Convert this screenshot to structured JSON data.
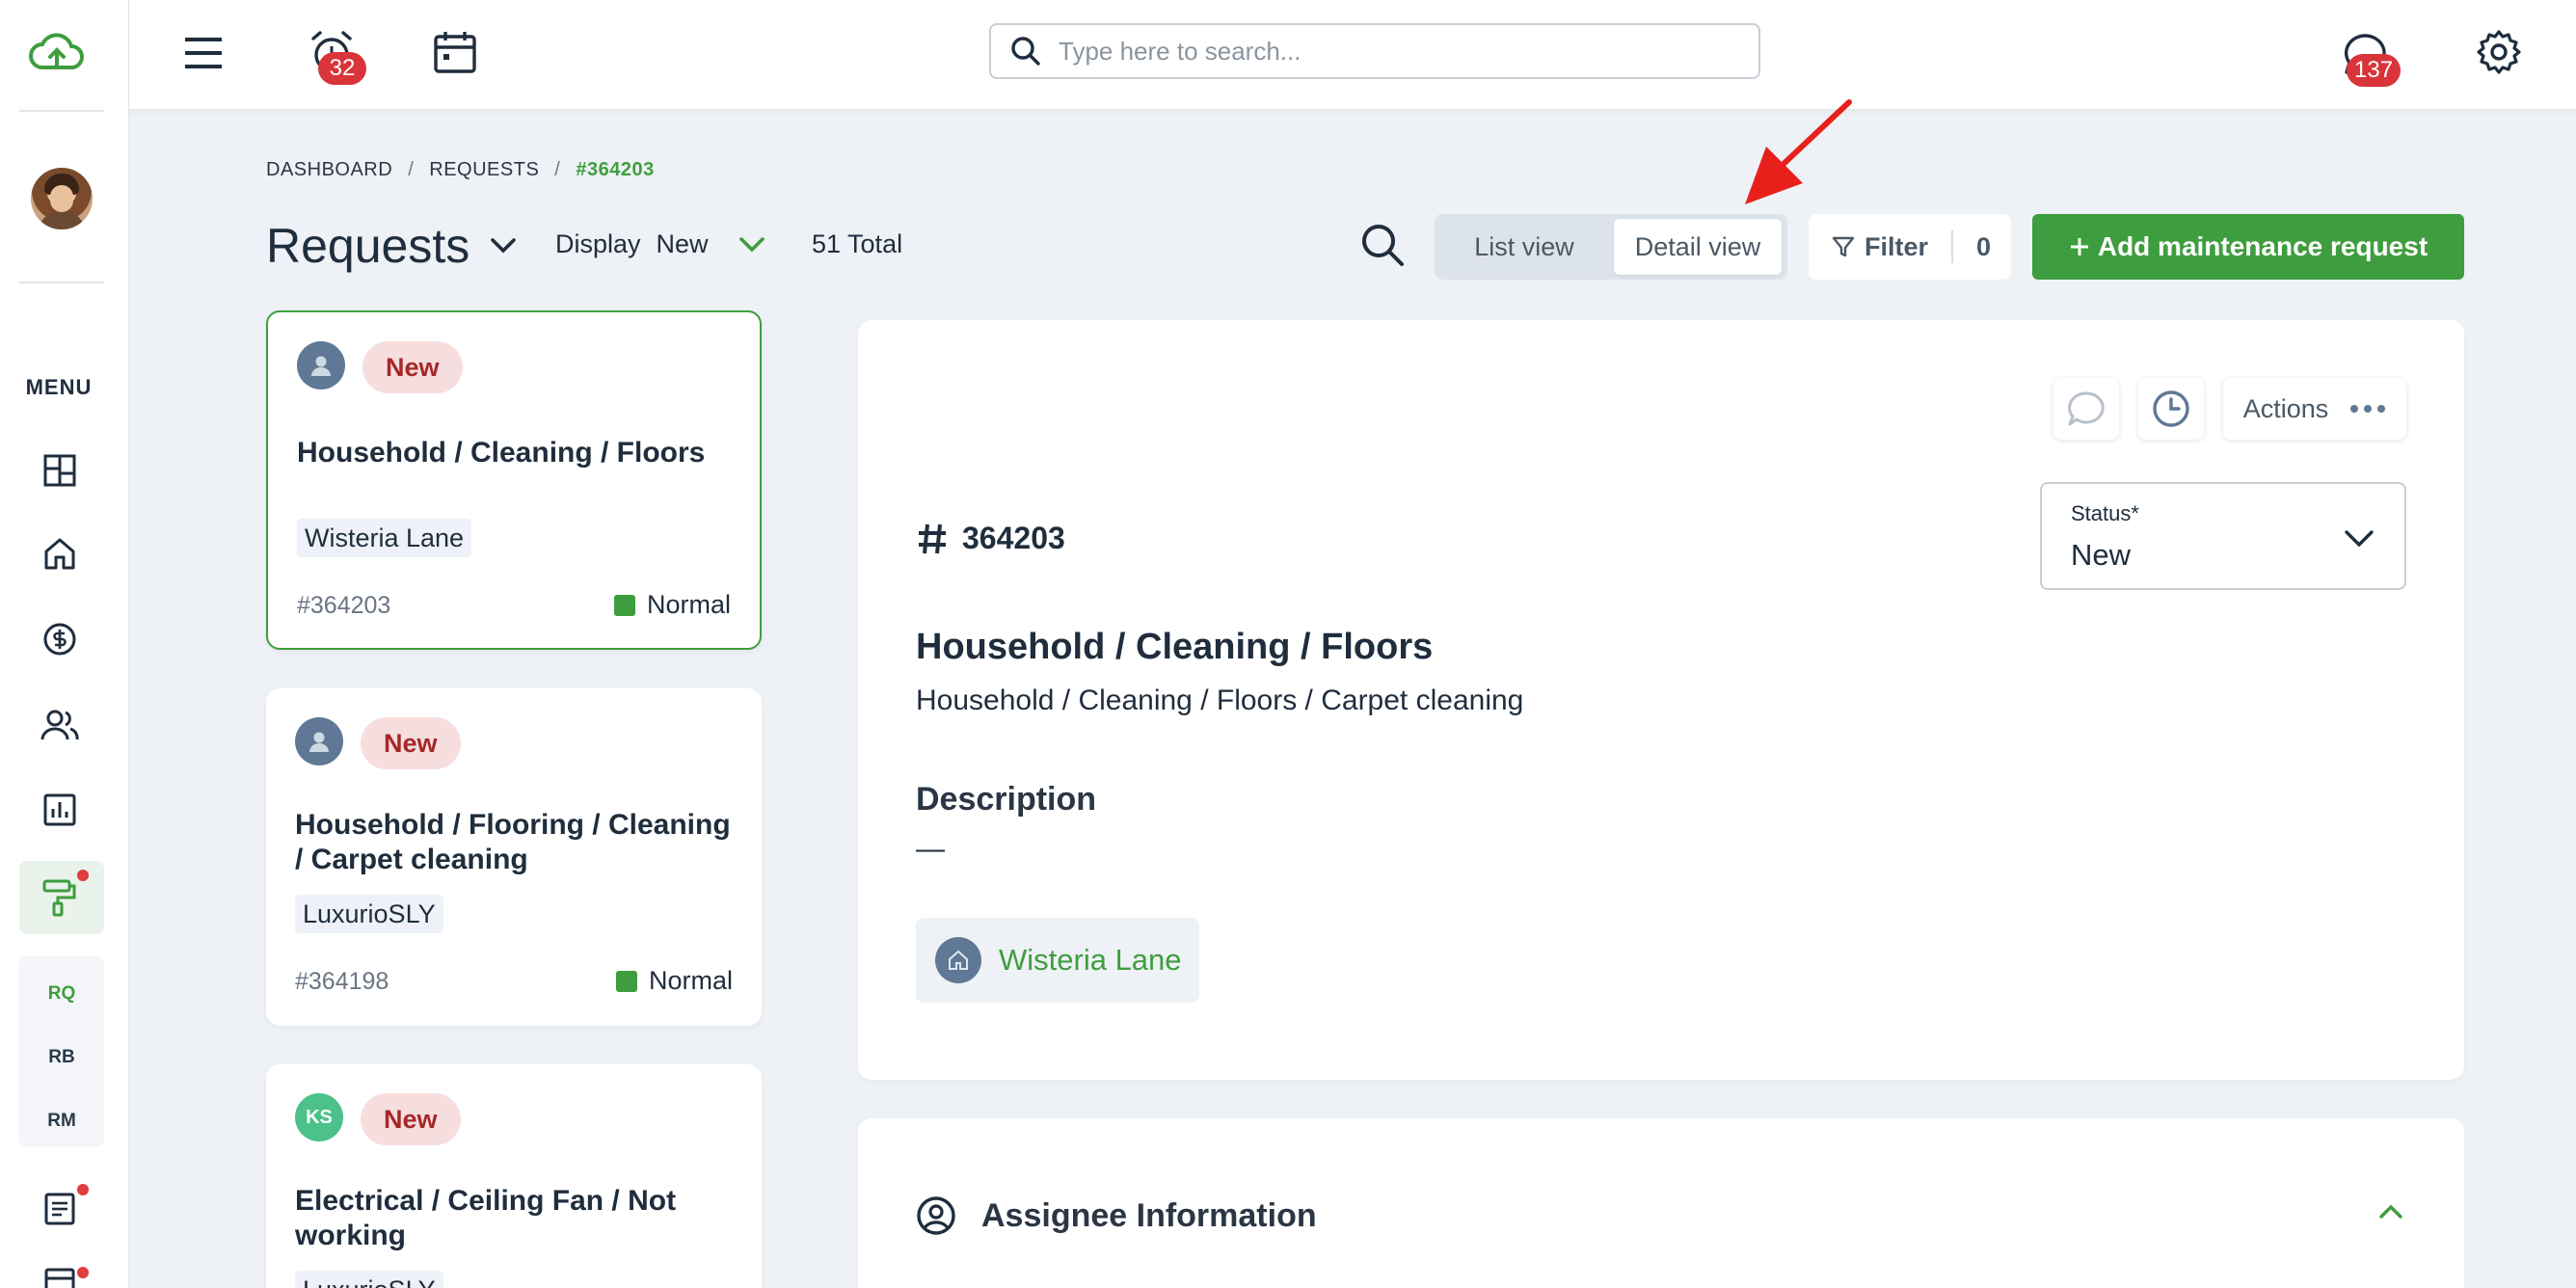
{
  "topbar": {
    "alarm_badge": "32",
    "chat_badge": "137",
    "search_placeholder": "Type here to search..."
  },
  "sidebar": {
    "menu_label": "MENU",
    "sub_items": [
      "RQ",
      "RB",
      "RM"
    ]
  },
  "breadcrumb": {
    "items": [
      "DASHBOARD",
      "REQUESTS"
    ],
    "current": "#364203",
    "separator": "/"
  },
  "header": {
    "title": "Requests",
    "display_label": "Display",
    "display_value": "New",
    "total": "51 Total",
    "list_view": "List view",
    "detail_view": "Detail view",
    "filter_label": "Filter",
    "filter_count": "0",
    "add_button": "Add maintenance request"
  },
  "cards": [
    {
      "status": "New",
      "title": "Household / Cleaning / Floors",
      "property": "Wisteria Lane",
      "id": "#364203",
      "priority": "Normal"
    },
    {
      "status": "New",
      "title": "Household / Flooring / Cleaning / Carpet cleaning",
      "property": "LuxurioSLY",
      "id": "#364198",
      "priority": "Normal"
    },
    {
      "status": "New",
      "title": "Electrical / Ceiling Fan / Not working",
      "avatar_initials": "KS",
      "property": "LuxurioSLY"
    }
  ],
  "detail": {
    "actions_label": "Actions",
    "status_label": "Status*",
    "status_value": "New",
    "id": "364203",
    "title": "Household / Cleaning / Floors",
    "subtitle": "Household / Cleaning / Floors / Carpet cleaning",
    "description_label": "Description",
    "description_value": "—",
    "property": "Wisteria Lane"
  },
  "assignee": {
    "title": "Assignee Information"
  },
  "colors": {
    "brand_green": "#3e9d3e",
    "badge_red": "#d9343a",
    "annotation_red": "#e8201c"
  }
}
